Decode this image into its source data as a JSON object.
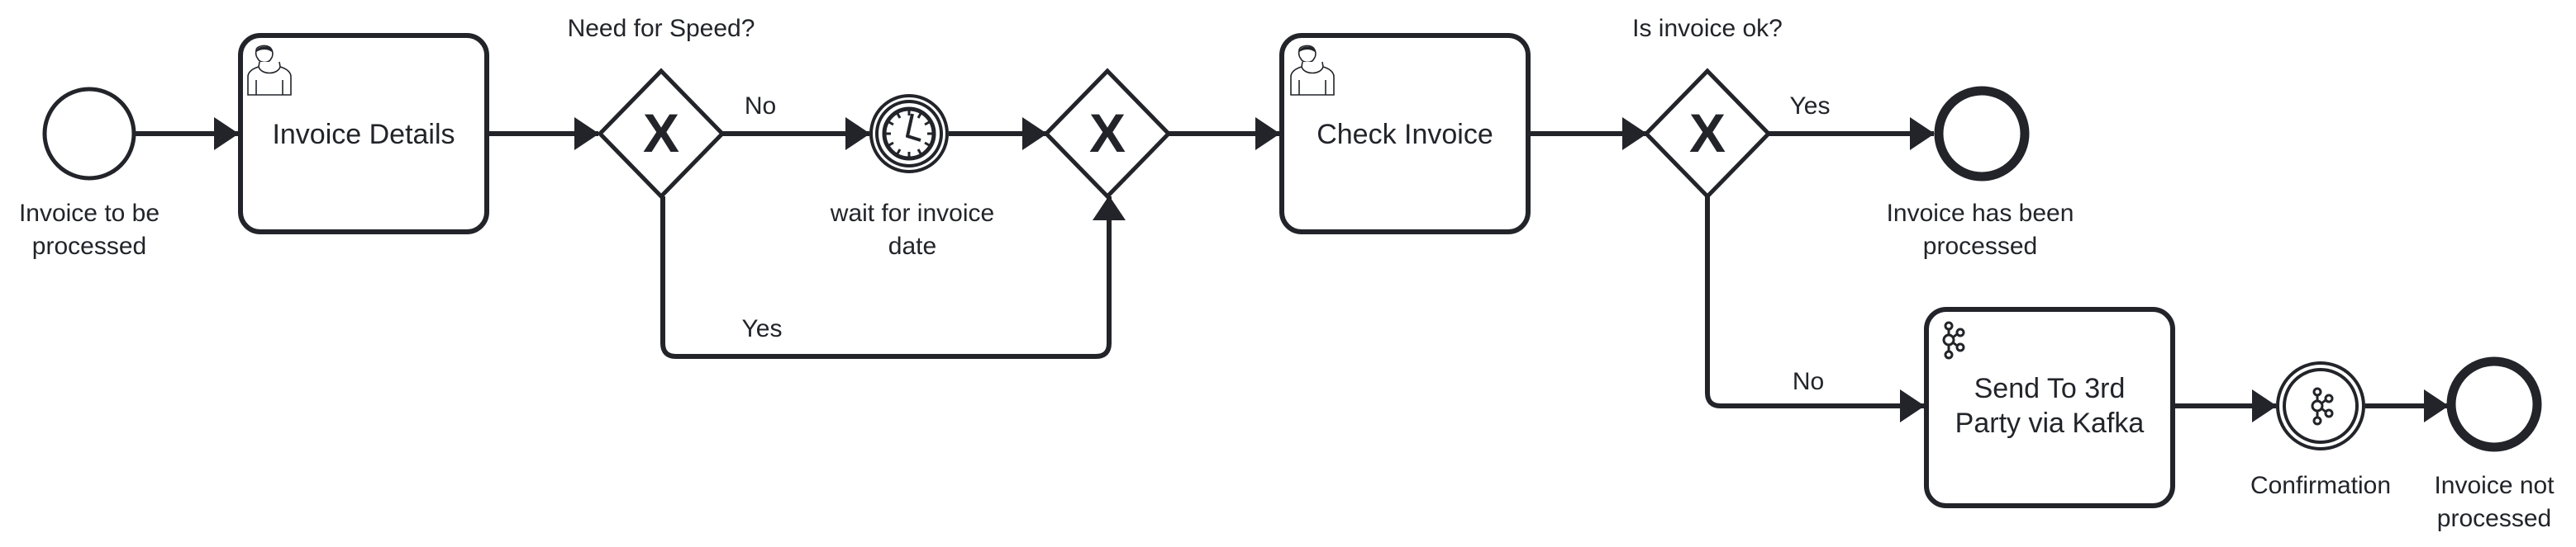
{
  "diagram": {
    "type": "BPMN process",
    "colors": {
      "stroke": "#22242a",
      "background": "#ffffff"
    },
    "start_event": {
      "label_line1": "Invoice to be",
      "label_line2": "processed",
      "icon": "start-event-circle"
    },
    "task_invoice_details": {
      "label": "Invoice Details",
      "icon": "user-task-icon"
    },
    "gateway_speed": {
      "question": "Need for Speed?",
      "marker": "X",
      "out_no": "No",
      "out_yes": "Yes"
    },
    "timer_event": {
      "label_line1": "wait for invoice",
      "label_line2": "date",
      "icon": "timer-clock-icon"
    },
    "gateway_merge": {
      "marker": "X"
    },
    "task_check_invoice": {
      "label": "Check Invoice",
      "icon": "user-task-icon"
    },
    "gateway_ok": {
      "question": "Is invoice ok?",
      "marker": "X",
      "out_yes": "Yes",
      "out_no": "No"
    },
    "end_processed": {
      "label_line1": "Invoice has been",
      "label_line2": "processed",
      "icon": "end-event-circle"
    },
    "task_kafka": {
      "label_line1": "Send To 3rd",
      "label_line2": "Party via Kafka",
      "icon": "kafka-icon"
    },
    "confirmation_event": {
      "label": "Confirmation",
      "icon": "kafka-icon"
    },
    "end_not_processed": {
      "label_line1": "Invoice not",
      "label_line2": "processed",
      "icon": "end-event-circle"
    }
  }
}
